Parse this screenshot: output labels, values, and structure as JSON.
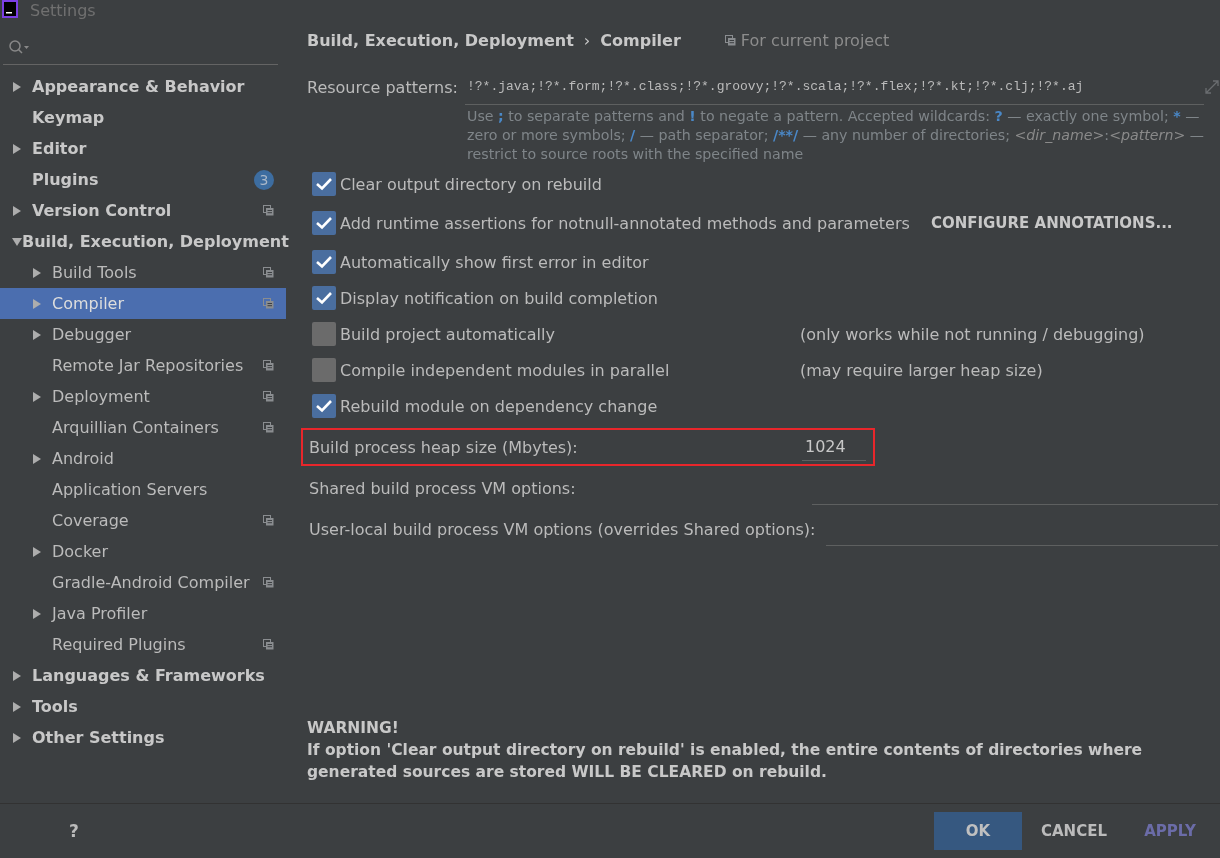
{
  "window": {
    "title": "Settings"
  },
  "sidebar": {
    "items": [
      {
        "label": "Appearance & Behavior",
        "kind": "group",
        "expanded": false,
        "selected": false,
        "project_level": false
      },
      {
        "label": "Keymap",
        "kind": "leaf",
        "selected": false,
        "project_level": false
      },
      {
        "label": "Editor",
        "kind": "group",
        "expanded": false,
        "selected": false,
        "project_level": false
      },
      {
        "label": "Plugins",
        "kind": "leaf",
        "selected": false,
        "project_level": false,
        "badge": "3"
      },
      {
        "label": "Version Control",
        "kind": "group",
        "expanded": false,
        "selected": false,
        "project_level": true
      },
      {
        "label": "Build, Execution, Deployment",
        "kind": "group",
        "expanded": true,
        "selected": false,
        "project_level": false,
        "children": [
          {
            "label": "Build Tools",
            "kind": "group",
            "expanded": false,
            "selected": false,
            "project_level": true
          },
          {
            "label": "Compiler",
            "kind": "group",
            "expanded": false,
            "selected": true,
            "project_level": true
          },
          {
            "label": "Debugger",
            "kind": "group",
            "expanded": false,
            "selected": false,
            "project_level": false
          },
          {
            "label": "Remote Jar Repositories",
            "kind": "leaf",
            "selected": false,
            "project_level": true
          },
          {
            "label": "Deployment",
            "kind": "group",
            "expanded": false,
            "selected": false,
            "project_level": true
          },
          {
            "label": "Arquillian Containers",
            "kind": "leaf",
            "selected": false,
            "project_level": true
          },
          {
            "label": "Android",
            "kind": "group",
            "expanded": false,
            "selected": false,
            "project_level": false
          },
          {
            "label": "Application Servers",
            "kind": "leaf",
            "selected": false,
            "project_level": false
          },
          {
            "label": "Coverage",
            "kind": "leaf",
            "selected": false,
            "project_level": true
          },
          {
            "label": "Docker",
            "kind": "group",
            "expanded": false,
            "selected": false,
            "project_level": false
          },
          {
            "label": "Gradle-Android Compiler",
            "kind": "leaf",
            "selected": false,
            "project_level": true
          },
          {
            "label": "Java Profiler",
            "kind": "group",
            "expanded": false,
            "selected": false,
            "project_level": false
          },
          {
            "label": "Required Plugins",
            "kind": "leaf",
            "selected": false,
            "project_level": true
          }
        ]
      },
      {
        "label": "Languages & Frameworks",
        "kind": "group",
        "expanded": false,
        "selected": false,
        "project_level": false
      },
      {
        "label": "Tools",
        "kind": "group",
        "expanded": false,
        "selected": false,
        "project_level": false
      },
      {
        "label": "Other Settings",
        "kind": "group",
        "expanded": false,
        "selected": false,
        "project_level": false
      }
    ]
  },
  "breadcrumb": {
    "parts": [
      "Build, Execution, Deployment",
      "Compiler"
    ],
    "separator": "›",
    "scope": "For current project"
  },
  "resource_patterns": {
    "label": "Resource patterns:",
    "value": "!?*.java;!?*.form;!?*.class;!?*.groovy;!?*.scala;!?*.flex;!?*.kt;!?*.clj;!?*.aj",
    "help": [
      {
        "kind": "text",
        "text": "Use "
      },
      {
        "kind": "symbol",
        "text": ";"
      },
      {
        "kind": "text",
        "text": " to separate patterns and "
      },
      {
        "kind": "symbol",
        "text": "!"
      },
      {
        "kind": "text",
        "text": " to negate a pattern. Accepted wildcards: "
      },
      {
        "kind": "symbol",
        "text": "?"
      },
      {
        "kind": "text",
        "text": " — exactly one symbol; "
      },
      {
        "kind": "symbol",
        "text": "*"
      },
      {
        "kind": "text",
        "text": " — zero or more symbols; "
      },
      {
        "kind": "symbol",
        "text": "/"
      },
      {
        "kind": "text",
        "text": " — path separator; "
      },
      {
        "kind": "symbol",
        "text": "/**/"
      },
      {
        "kind": "text",
        "text": " — any number of directories; "
      },
      {
        "kind": "italic",
        "text": "<dir_name>"
      },
      {
        "kind": "text",
        "text": ":"
      },
      {
        "kind": "italic",
        "text": "<pattern>"
      },
      {
        "kind": "text",
        "text": " — restrict to source roots with the specified name"
      }
    ]
  },
  "options": [
    {
      "label": "Clear output directory on rebuild",
      "checked": true
    },
    {
      "label": "Add runtime assertions for notnull-annotated methods and parameters",
      "checked": true,
      "action": "CONFIGURE ANNOTATIONS..."
    },
    {
      "label": "Automatically show first error in editor",
      "checked": true
    },
    {
      "label": "Display notification on build completion",
      "checked": true
    },
    {
      "label": "Build project automatically",
      "checked": false,
      "note": "(only works while not running / debugging)"
    },
    {
      "label": "Compile independent modules in parallel",
      "checked": false,
      "note": "(may require larger heap size)"
    },
    {
      "label": "Rebuild module on dependency change",
      "checked": true
    }
  ],
  "fields": [
    {
      "kind": "short",
      "label": "Build process heap size (Mbytes):",
      "value": "1024",
      "highlighted": true
    },
    {
      "kind": "wide",
      "label": "Shared build process VM options:",
      "highlighted": false
    },
    {
      "kind": "wide",
      "label": "User-local build process VM options (overrides Shared options):",
      "highlighted": false
    }
  ],
  "warning": {
    "title": "WARNING!",
    "text": "If option 'Clear output directory on rebuild' is enabled, the entire contents of directories where generated sources are stored WILL BE CLEARED on rebuild."
  },
  "help_button": "?",
  "buttons": [
    {
      "label": "OK",
      "default": true,
      "disabled": false
    },
    {
      "label": "CANCEL",
      "default": false,
      "disabled": false
    },
    {
      "label": "APPLY",
      "default": false,
      "disabled": true
    }
  ]
}
